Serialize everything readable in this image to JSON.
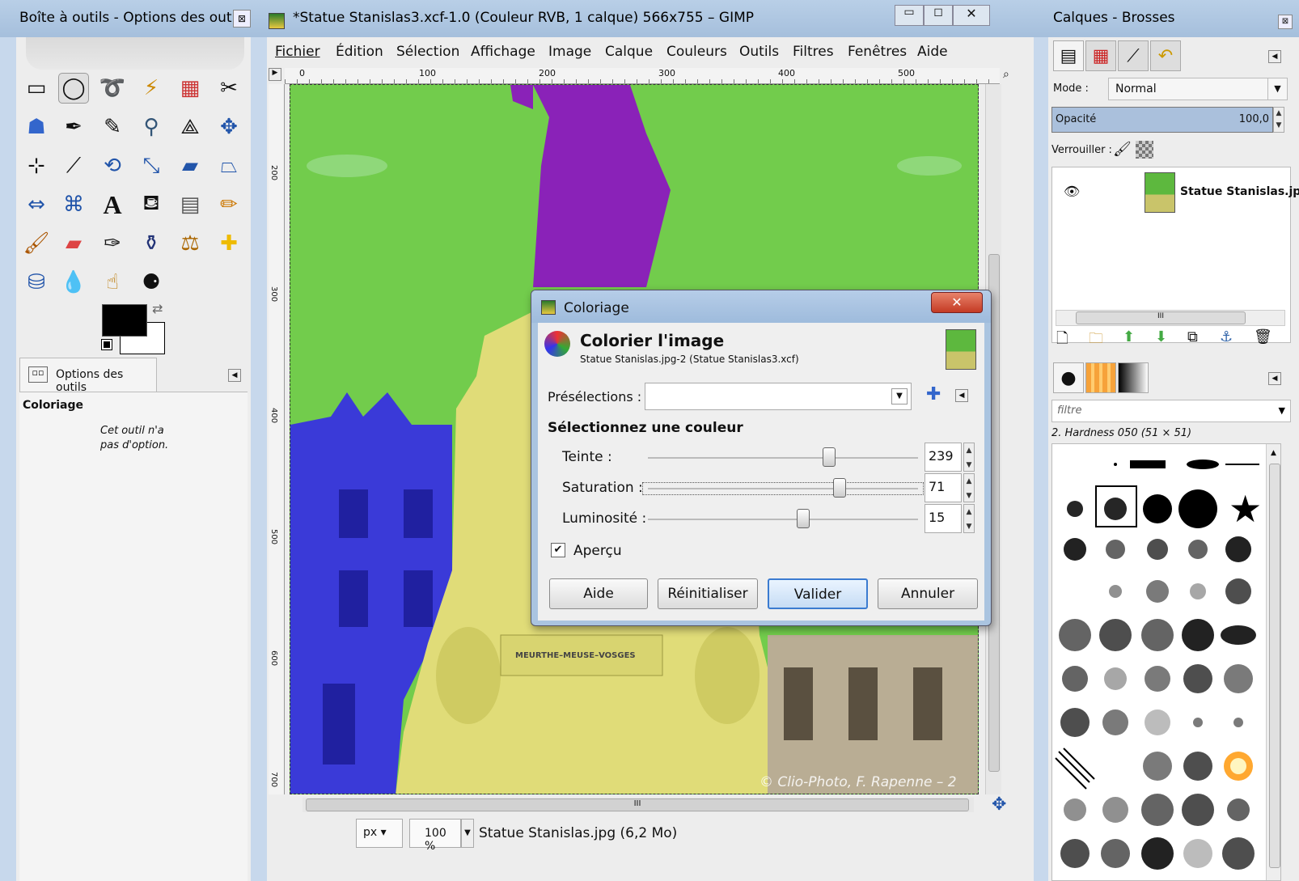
{
  "toolbox": {
    "title": "Boîte à outils - Options des out...",
    "options_tab": "Options des outils",
    "tool_name": "Coloriage",
    "tool_note_1": "Cet outil n'a",
    "tool_note_2": "pas d'option."
  },
  "gimp": {
    "title": "*Statue Stanislas3.xcf-1.0 (Couleur RVB, 1 calque) 566x755 – GIMP",
    "menu": [
      "Fichier",
      "Édition",
      "Sélection",
      "Affichage",
      "Image",
      "Calque",
      "Couleurs",
      "Outils",
      "Filtres",
      "Fenêtres",
      "Aide"
    ],
    "ruler_h": [
      "0",
      "100",
      "200",
      "300",
      "400",
      "500"
    ],
    "ruler_v": [
      "200",
      "300",
      "400",
      "500",
      "600",
      "700"
    ],
    "watermark": "© Clio-Photo, F. Rapenne – 2",
    "unit": "px",
    "zoom": "100 %",
    "status": "Statue Stanislas.jpg (6,2 Mo)",
    "scroll_label": "III"
  },
  "dialog": {
    "title": "Coloriage",
    "heading": "Colorier l'image",
    "subheading": "Statue Stanislas.jpg-2 (Statue Stanislas3.xcf)",
    "presets_label": "Présélections :",
    "select_color_label": "Sélectionnez une couleur",
    "hue": {
      "label": "Teinte :",
      "value": "239",
      "fraction": 0.67
    },
    "saturation": {
      "label": "Saturation :",
      "value": "71",
      "fraction": 0.71
    },
    "lightness": {
      "label": "Luminosité :",
      "value": "15",
      "fraction": 0.575
    },
    "preview": "Aperçu",
    "buttons": {
      "help": "Aide",
      "reset": "Réinitialiser",
      "ok": "Valider",
      "cancel": "Annuler"
    },
    "statue_plaque": "MEURTHE–MEUSE–VOSGES"
  },
  "layers": {
    "title": "Calques - Brosses",
    "mode_label": "Mode :",
    "mode_value": "Normal",
    "opacity_label": "Opacité",
    "opacity_value": "100,0",
    "lock_label": "Verrouiller :",
    "layer_name": "Statue Stanislas.jp",
    "scroll_label": "III",
    "brush_filter": "filtre",
    "brush_name": "2. Hardness 050 (51 × 51)"
  }
}
